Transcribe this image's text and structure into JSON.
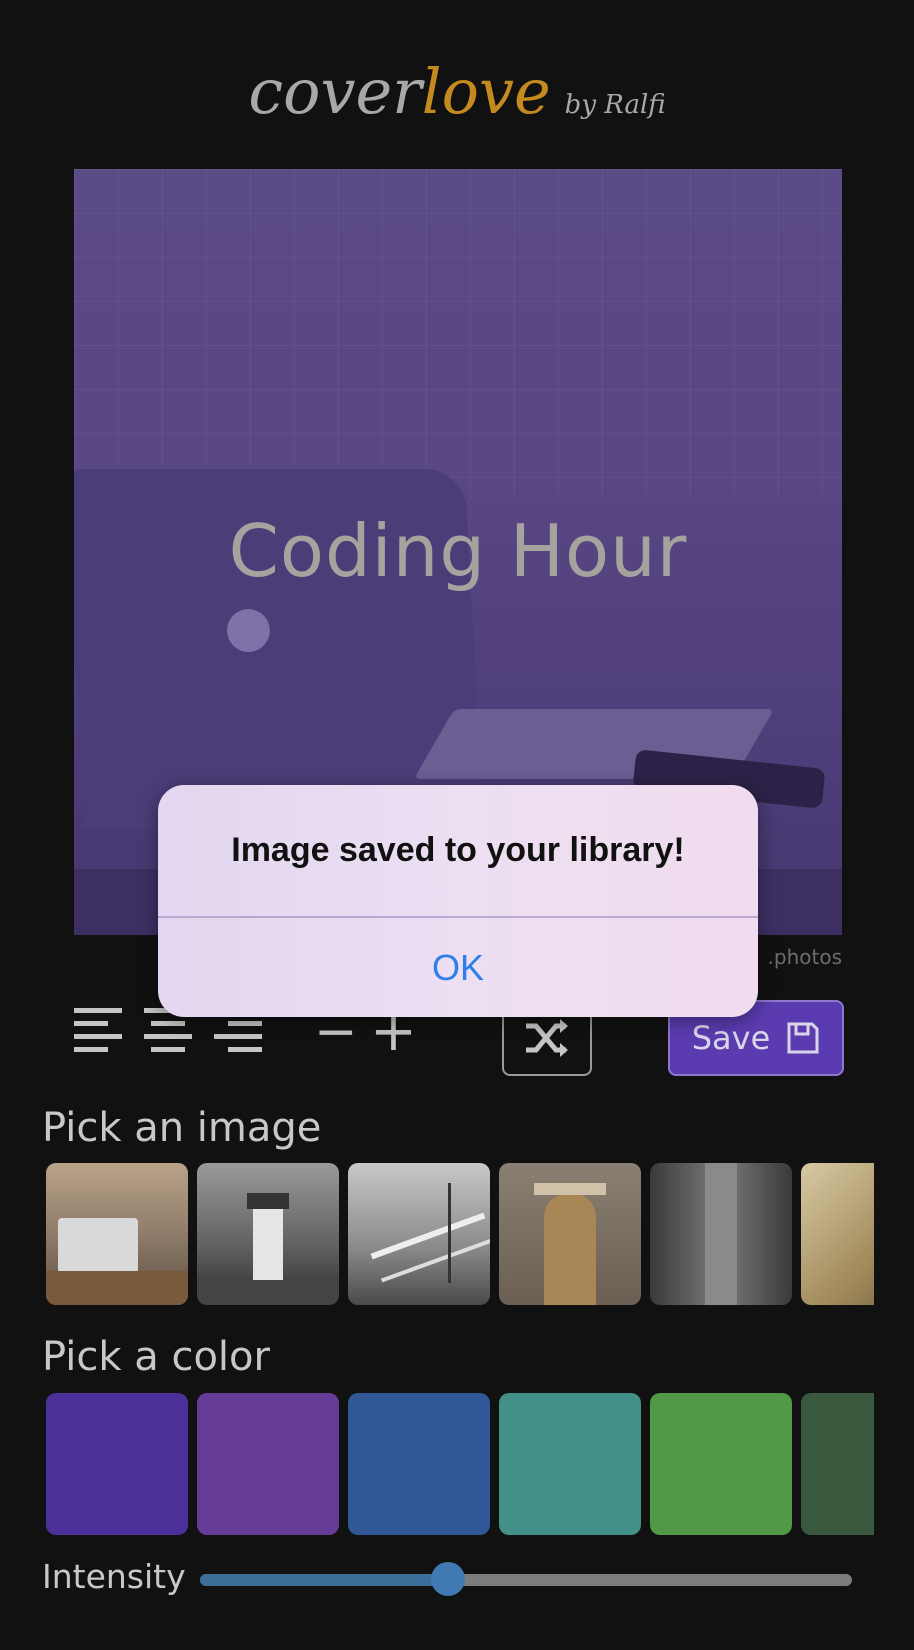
{
  "header": {
    "logo_part1": "cover",
    "logo_part2": "love",
    "logo_byline": "by Ralfi"
  },
  "cover": {
    "title": "Coding Hour",
    "credit": ".photos"
  },
  "toolbar": {
    "align_left_icon": "align-left-icon",
    "align_center_icon": "align-center-icon",
    "align_right_icon": "align-right-icon",
    "decrease_label": "−",
    "increase_label": "+",
    "shuffle_icon": "shuffle-icon",
    "save_label": "Save",
    "save_icon": "floppy-disk-icon"
  },
  "image_picker": {
    "label": "Pick an image",
    "images": [
      "laptop-desk",
      "lighthouse",
      "pier",
      "doorway",
      "city-street",
      "wheat-field"
    ]
  },
  "color_picker": {
    "label": "Pick a color",
    "colors": [
      "#4a3098",
      "#673c99",
      "#305796",
      "#439089",
      "#519947",
      "#3a5a40"
    ]
  },
  "intensity": {
    "label": "Intensity",
    "value": 0.38
  },
  "dialog": {
    "message": "Image saved to your library!",
    "ok_label": "OK"
  },
  "colors": {
    "accent": "#5b3cb0",
    "logo_love": "#c48a1e",
    "dialog_button": "#2f7fea"
  }
}
